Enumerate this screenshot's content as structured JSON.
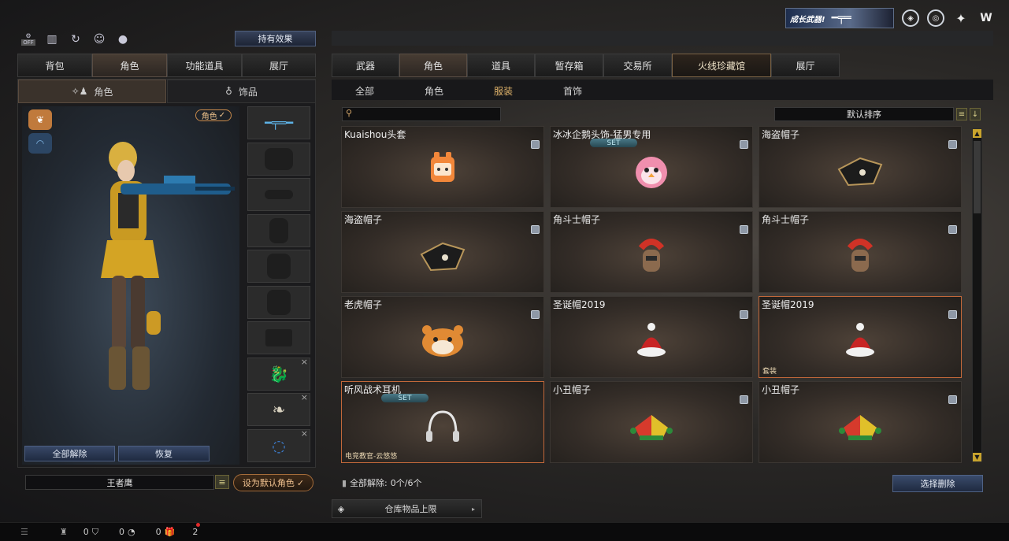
{
  "promo": {
    "text": "成长武器!"
  },
  "top_icons": [
    "shield-icon",
    "globe-icon",
    "settings-icon",
    "w-logo-icon"
  ],
  "left_icons": [
    "off-toggle-icon",
    "ranking-icon",
    "refresh-icon",
    "friends-icon",
    "penguin-icon"
  ],
  "off_label": "OFF",
  "hold_effect": "持有效果",
  "left_tabs": [
    {
      "label": "背包"
    },
    {
      "label": "角色"
    },
    {
      "label": "功能道具"
    },
    {
      "label": "展厅"
    }
  ],
  "left_subtabs": [
    {
      "label": "角色"
    },
    {
      "label": "饰品"
    }
  ],
  "char_badge": "角色",
  "left_buttons": {
    "release_all": "全部解除",
    "restore": "恢复",
    "set_default": "设为默认角色"
  },
  "char_name": "王者鹰",
  "right_tabs": [
    {
      "label": "武器"
    },
    {
      "label": "角色"
    },
    {
      "label": "道具"
    },
    {
      "label": "暂存箱"
    },
    {
      "label": "交易所"
    },
    {
      "label": "火线珍藏馆"
    },
    {
      "label": "展厅"
    }
  ],
  "categories": [
    {
      "label": "全部"
    },
    {
      "label": "角色"
    },
    {
      "label": "服装"
    },
    {
      "label": "首饰"
    }
  ],
  "sort": {
    "label": "默认排序"
  },
  "items": [
    {
      "name": "Kuaishou头套",
      "set": "",
      "tag": ""
    },
    {
      "name": "冰冰企鹅头饰-猛男专用",
      "set": "SET",
      "tag": ""
    },
    {
      "name": "海盗帽子",
      "set": "",
      "tag": ""
    },
    {
      "name": "海盗帽子",
      "set": "",
      "tag": ""
    },
    {
      "name": "角斗士帽子",
      "set": "",
      "tag": ""
    },
    {
      "name": "角斗士帽子",
      "set": "",
      "tag": ""
    },
    {
      "name": "老虎帽子",
      "set": "",
      "tag": ""
    },
    {
      "name": "圣诞帽2019",
      "set": "",
      "tag": ""
    },
    {
      "name": "圣诞帽2019",
      "set": "",
      "tag": "套装"
    },
    {
      "name": "听风战术耳机",
      "set": "SET",
      "tag": "电竞教官-云悠悠"
    },
    {
      "name": "小丑帽子",
      "set": "",
      "tag": ""
    },
    {
      "name": "小丑帽子",
      "set": "",
      "tag": ""
    }
  ],
  "release_count": {
    "label": "全部解除:",
    "value": "0个/6个"
  },
  "select_release": "选择删除",
  "warehouse": "仓库物品上限",
  "footer": {
    "count1": "0",
    "count2": "0",
    "count3": "0",
    "count4": "2"
  }
}
